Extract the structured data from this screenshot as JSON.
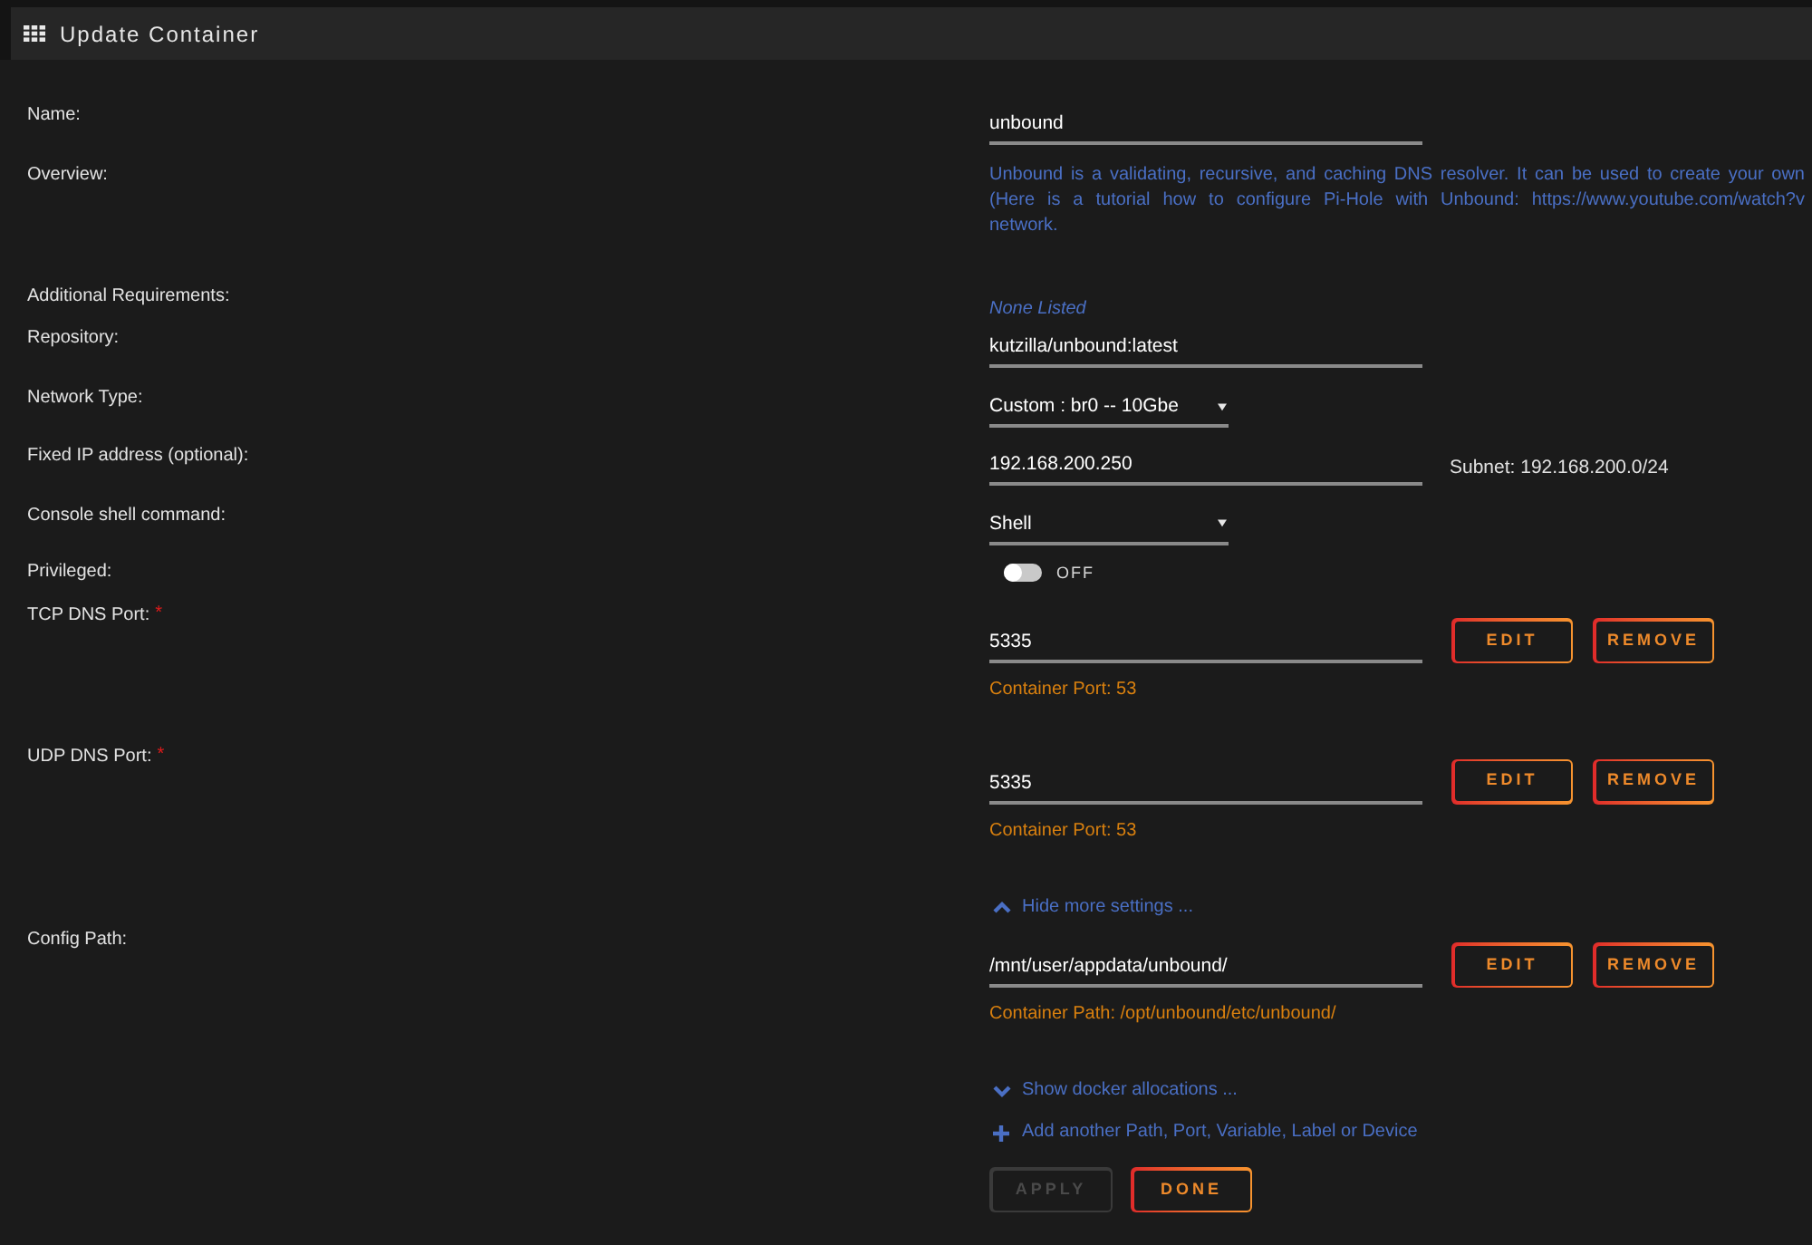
{
  "window": {
    "title": "Update Container"
  },
  "fields": [
    {
      "kind": "text_input",
      "label": "Name:",
      "value": "unbound"
    },
    {
      "kind": "description",
      "label": "Overview:",
      "lines": [
        "Unbound is a validating, recursive, and caching DNS resolver. It can be used to create your own",
        "(Here is a tutorial how to configure Pi-Hole with Unbound: https://www.youtube.com/watch?v",
        "network."
      ]
    },
    {
      "kind": "note",
      "label": "Additional Requirements:",
      "text": "None Listed"
    },
    {
      "kind": "text_input",
      "label": "Repository:",
      "value": "kutzilla/unbound:latest"
    },
    {
      "kind": "select",
      "label": "Network Type:",
      "value": "Custom : br0 -- 10Gbe"
    },
    {
      "kind": "text_input",
      "label": "Fixed IP address (optional):",
      "value": "192.168.200.250",
      "aside": "Subnet: 192.168.200.0/24"
    },
    {
      "kind": "select",
      "label": "Console shell command:",
      "value": "Shell"
    },
    {
      "kind": "toggle",
      "label": "Privileged:",
      "on": false,
      "state_text": "OFF"
    },
    {
      "kind": "config",
      "label": "TCP DNS Port:",
      "required_mark": "*",
      "value": "5335",
      "buttons": [
        "EDIT",
        "REMOVE"
      ],
      "hint": "Container Port: 53"
    },
    {
      "kind": "config",
      "label": "UDP DNS Port:",
      "required_mark": "*",
      "value": "5335",
      "buttons": [
        "EDIT",
        "REMOVE"
      ],
      "hint": "Container Port: 53"
    },
    {
      "kind": "collapse_link",
      "text": "Hide more settings ..."
    },
    {
      "kind": "config",
      "label": "Config Path:",
      "value": "/mnt/user/appdata/unbound/",
      "buttons": [
        "EDIT",
        "REMOVE"
      ],
      "hint": "Container Path: /opt/unbound/etc/unbound/"
    },
    {
      "kind": "expand_link",
      "text": "Show docker allocations ..."
    },
    {
      "kind": "add_link",
      "text": "Add another Path, Port, Variable, Label or Device"
    }
  ],
  "actions": [
    {
      "label": "APPLY",
      "disabled": true
    },
    {
      "label": "DONE",
      "disabled": false
    }
  ]
}
